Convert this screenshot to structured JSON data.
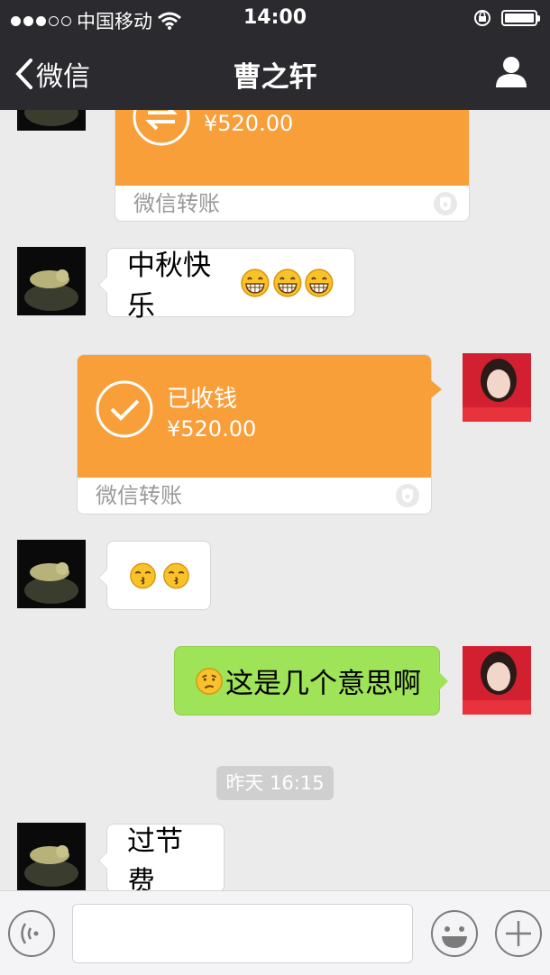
{
  "status_bar": {
    "carrier": "中国移动",
    "time": "14:00"
  },
  "nav": {
    "back_label": "微信",
    "title": "曹之轩"
  },
  "messages": [
    {
      "type": "transfer",
      "side": "left",
      "title": "",
      "amount": "¥520.00",
      "footer": "微信转账"
    },
    {
      "type": "text",
      "side": "left",
      "text": "中秋快乐",
      "emojis": [
        "grin",
        "grin",
        "grin"
      ]
    },
    {
      "type": "transfer",
      "side": "right",
      "title": "已收钱",
      "amount": "¥520.00",
      "footer": "微信转账"
    },
    {
      "type": "emoji",
      "side": "left",
      "emojis": [
        "kiss",
        "kiss"
      ]
    },
    {
      "type": "text",
      "side": "right",
      "text": "这是几个意思啊",
      "emojis": [
        "thinking"
      ]
    },
    {
      "type": "timestamp",
      "text": "昨天 16:15"
    },
    {
      "type": "text",
      "side": "left",
      "text": "过节费"
    }
  ],
  "input": {
    "placeholder": ""
  },
  "colors": {
    "nav_bg": "#2b2b2f",
    "transfer_orange": "#f89f3a",
    "bubble_green": "#9fe358",
    "chat_bg": "#ebebeb"
  }
}
